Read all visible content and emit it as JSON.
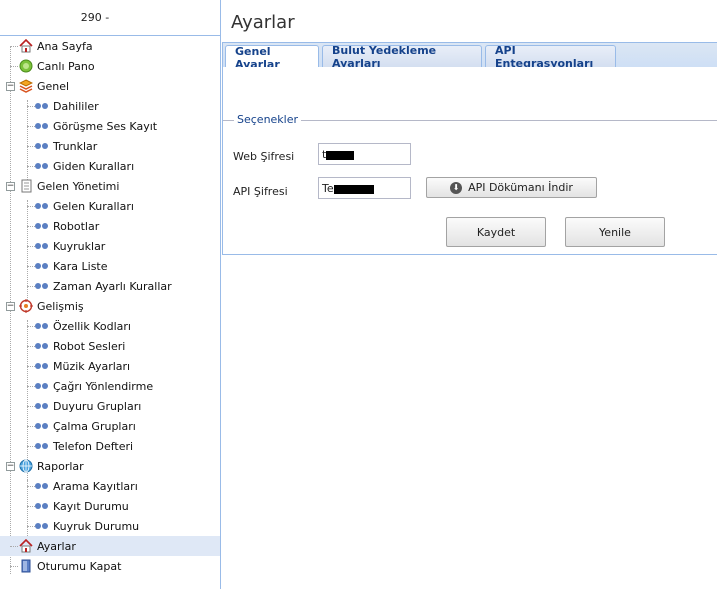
{
  "sidebar": {
    "header": "290 -",
    "items": [
      {
        "label": "Ana Sayfa",
        "icon": "home-icon"
      },
      {
        "label": "Canlı Pano",
        "icon": "live-board-icon"
      },
      {
        "label": "Genel",
        "icon": "general-layers-icon"
      },
      {
        "label": "Dahililer"
      },
      {
        "label": "Görüşme Ses Kayıt"
      },
      {
        "label": "Trunklar"
      },
      {
        "label": "Giden Kuralları"
      },
      {
        "label": "Gelen Yönetimi",
        "icon": "document-icon"
      },
      {
        "label": "Gelen Kuralları"
      },
      {
        "label": "Robotlar"
      },
      {
        "label": "Kuyruklar"
      },
      {
        "label": "Kara Liste"
      },
      {
        "label": "Zaman Ayarlı Kurallar"
      },
      {
        "label": "Gelişmiş",
        "icon": "advanced-gear-icon"
      },
      {
        "label": "Özellik Kodları"
      },
      {
        "label": "Robot Sesleri"
      },
      {
        "label": "Müzik Ayarları"
      },
      {
        "label": "Çağrı Yönlendirme"
      },
      {
        "label": "Duyuru Grupları"
      },
      {
        "label": "Çalma Grupları"
      },
      {
        "label": "Telefon Defteri"
      },
      {
        "label": "Raporlar",
        "icon": "reports-globe-icon"
      },
      {
        "label": "Arama Kayıtları"
      },
      {
        "label": "Kayıt Durumu"
      },
      {
        "label": "Kuyruk Durumu"
      },
      {
        "label": "Ayarlar",
        "icon": "settings-home-icon"
      },
      {
        "label": "Oturumu Kapat",
        "icon": "logout-door-icon"
      }
    ]
  },
  "main": {
    "title": "Ayarlar",
    "tabs": [
      {
        "label": "Genel Ayarlar",
        "active": true
      },
      {
        "label": "Bulut Yedekleme Ayarları",
        "active": false
      },
      {
        "label": "API Entegrasyonları",
        "active": false
      }
    ],
    "fieldset_legend": "Seçenekler",
    "web_password_label": "Web Şifresi",
    "web_password_value": "t",
    "api_password_label": "API Şifresi",
    "api_password_value": "Te",
    "api_doc_button": "API Dökümanı İndir",
    "save_button": "Kaydet",
    "refresh_button": "Yenile"
  },
  "colors": {
    "accent": "#15428b",
    "border": "#99bbe8",
    "selected_row": "#dfe8f6",
    "tree_dots": "#5a7fc2"
  }
}
